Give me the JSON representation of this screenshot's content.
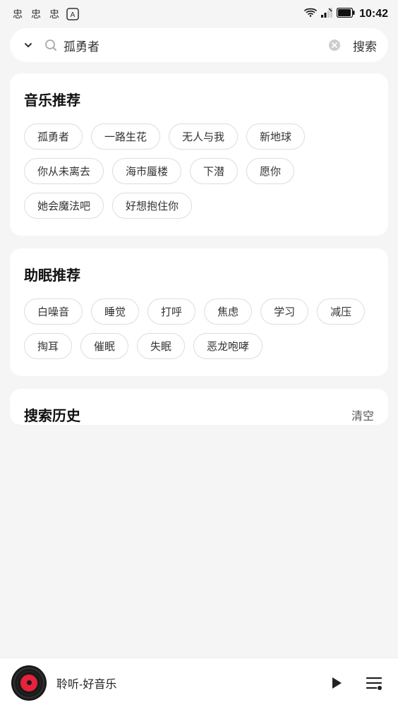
{
  "statusBar": {
    "time": "10:42",
    "icons": [
      "忠",
      "忠",
      "忠"
    ]
  },
  "searchBar": {
    "dropdown_label": "▼",
    "query": "孤勇者",
    "clear_label": "×",
    "search_label": "搜索"
  },
  "musicSection": {
    "title": "音乐推荐",
    "tags": [
      "孤勇者",
      "一路生花",
      "无人与我",
      "新地球",
      "你从未离去",
      "海市蜃楼",
      "下潜",
      "愿你",
      "她会魔法吧",
      "好想抱住你"
    ]
  },
  "sleepSection": {
    "title": "助眠推荐",
    "tags": [
      "白噪音",
      "睡觉",
      "打呼",
      "焦虑",
      "学习",
      "减压",
      "掏耳",
      "催眠",
      "失眠",
      "恶龙咆哮"
    ]
  },
  "historySection": {
    "title": "搜索历史",
    "clear_label": "清空"
  },
  "player": {
    "title": "聆听-好音乐",
    "play_label": "▶",
    "list_label": "≡"
  }
}
